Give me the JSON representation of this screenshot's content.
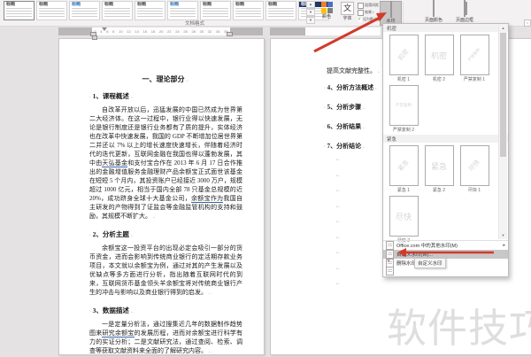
{
  "ribbon": {
    "style_gallery": {
      "card_label": "标题",
      "card_count": 10,
      "group_label": "文档格式"
    },
    "buttons": {
      "colors": "颜色",
      "fonts": "字体",
      "paragraph_spacing": "段落间距",
      "effects": "效果",
      "set_default": "设为默认值",
      "watermark": "水印",
      "page_color": "页面颜色",
      "page_borders": "页面边框"
    }
  },
  "ruler": {
    "numbers": [
      "2",
      "4",
      "6",
      "8",
      "10",
      "12",
      "14",
      "16",
      "18",
      "20",
      "22",
      "24",
      "26",
      "28",
      "30",
      "32",
      "34",
      "36"
    ]
  },
  "document": {
    "mark_prefix": "·",
    "mark_eol": "←",
    "page1": {
      "title": "一、理论部分",
      "sections": [
        {
          "heading": "1、课程概述",
          "body": "自改革开放以后，迅猛发展的中国已然成为世界第二大经济体。在这一过程中，银行业得以快速发展，无论是银行制度还是银行业务都有了质的提升，实体经济也在改革中快速发展，我国的 GDP 不断增加位居世界第二并还以 7% 以上的增长速度快速增长，伴随着经济时代的迭代更新，互联网金融在我国也得以蓬勃发展，其中由天弘基金和支付宝合作在 2013 年 6 月 17 日合作推出的金融增值服务金融理财产品余额宝正式面世该基金在短短 5 个月内，其投资账户已经接近 3000 万户，规模超过 1000 亿元，相当于国内全部 78 只基金总规模的近 20%，成功跻身全球十大基金公司，余额宝作为我国自主研发的产物得到了证监会等金融监管机构的支持和鼓励，其规模不断扩大。"
        },
        {
          "heading": "2、分析主题",
          "body": "余额宝这一投资平台的出现必定会吸引一部分的货币资金，进而会影响到传统商业银行的定活期存款业务项目，本文就以余额宝为例，通过对其的产生发展以及优缺点等多方面进行分析，指出随着互联网时代的到来，互联网货币基金领头羊余额宝将对传统商业银行产生的冲击与影响以及商业银行得到的启发。"
        },
        {
          "heading": "3、数据描述",
          "body": "一是定量分析法，通过搜集近几年的数据制作趋势图来研究余额宝的发展历程，进而对余额宝进行科学有力的实证分析；二是文献研究法，通过查阅、检索、调查等获取文献资料来全面的了解研究内容。"
        }
      ],
      "underlined_phrases": [
        "天弘基金",
        "余额宝作为",
        "研究余额宝"
      ]
    },
    "page2": {
      "continuation_line": "提高文献完整性。",
      "headings": [
        "4、分析方法概述",
        "5、分析步骤",
        "6、分析结果",
        "7、分析结论"
      ],
      "empty_mark_count": 9
    }
  },
  "watermark_menu": {
    "sections": [
      {
        "label": "机密",
        "items": [
          {
            "name": "机密 1",
            "text": "机密",
            "diagonal": true
          },
          {
            "name": "机密 2",
            "text": "机密",
            "diagonal": false
          },
          {
            "name": "严禁复制 1",
            "text": "严禁复制",
            "diagonal": true
          },
          {
            "name": "严禁复制 2",
            "text": "严禁复制",
            "diagonal": false
          }
        ]
      },
      {
        "label": "紧急",
        "items": [
          {
            "name": "紧急 1",
            "text": "紧急",
            "diagonal": true
          },
          {
            "name": "紧急 2",
            "text": "紧急",
            "diagonal": false
          },
          {
            "name": "尽快 1",
            "text": "尽快",
            "diagonal": true
          },
          {
            "name": "尽快 2",
            "text": "尽快",
            "diagonal": false
          }
        ]
      }
    ],
    "commands": [
      {
        "label": "Office.com 中的其他水印(M)",
        "icon": "office-watermarks-icon",
        "has_submenu": true
      },
      {
        "label": "自定义水印(W)...",
        "icon": "custom-watermark-icon",
        "highlighted": true
      },
      {
        "label": "删除水印(R)",
        "icon": "delete-watermark-icon"
      }
    ],
    "tooltip": "自定义水印"
  },
  "overlay": {
    "watermark_text": "软件技巧"
  },
  "colors": {
    "arrow": "#d23a2a",
    "menu_highlight": "#c9c7c8",
    "video_watermark": "#dedede"
  }
}
